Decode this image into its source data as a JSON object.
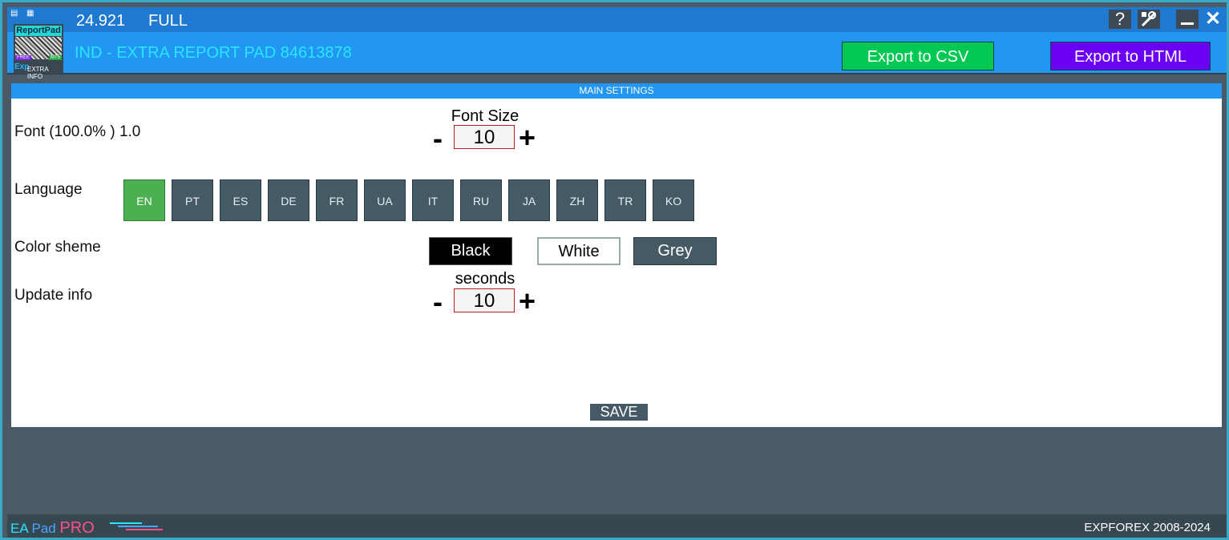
{
  "titlebar": {
    "version": "24.921",
    "mode": "FULL",
    "help_label": "?",
    "tools_icon": "tools-icon",
    "minimize_icon": "minimize-icon",
    "close_label": "✕"
  },
  "logo": {
    "top_text": "ReportPad",
    "free_badge": "FREE",
    "mt5_badge": "MT5",
    "exp_text": "Exp",
    "extra_text": "EXTRA INFO"
  },
  "header": {
    "title": "IND - EXTRA REPORT PAD 84613878",
    "export_csv_label": "Export to CSV",
    "export_html_label": "Export to HTML",
    "csv_color": "#00c853",
    "html_color": "#6a00f4"
  },
  "section": {
    "title": "MAIN SETTINGS"
  },
  "settings": {
    "font_label": "Font  (100.0% ) 1.0",
    "font_size_caption": "Font Size",
    "font_size_value": "10",
    "language_label": "Language",
    "languages": [
      "EN",
      "PT",
      "ES",
      "DE",
      "FR",
      "UA",
      "IT",
      "RU",
      "JA",
      "ZH",
      "TR",
      "KO"
    ],
    "active_language": "EN",
    "color_scheme_label": "Color sheme",
    "schemes": {
      "black": "Black",
      "white": "White",
      "grey": "Grey"
    },
    "update_label": "Update info",
    "update_caption": "seconds",
    "update_value": "10",
    "minus": "-",
    "plus": "+",
    "save_label": "SAVE"
  },
  "footer": {
    "brand_ea": "EA",
    "brand_pad": "Pad",
    "brand_pro": "PRO",
    "copyright": "EXPFOREX 2008-2024"
  }
}
